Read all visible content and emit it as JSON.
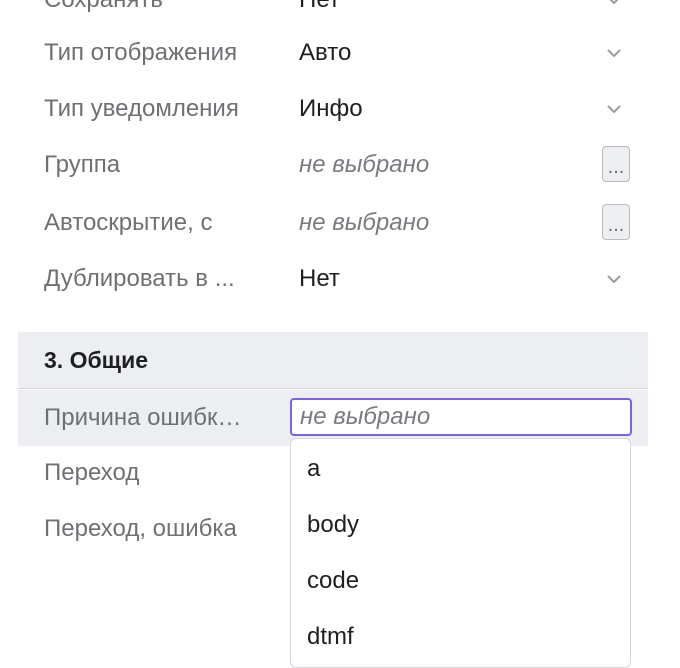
{
  "fields": {
    "save": {
      "label": "Сохранять",
      "value": "Нет"
    },
    "display_type": {
      "label": "Тип отображения",
      "value": "Авто"
    },
    "notification_type": {
      "label": "Тип уведомления",
      "value": "Инфо"
    },
    "group": {
      "label": "Группа",
      "value": "не выбрано",
      "button": "..."
    },
    "autohide": {
      "label": "Автоскрытие, с",
      "value": "не выбрано",
      "button": "..."
    },
    "duplicate": {
      "label": "Дублировать в ...",
      "value": "Нет"
    }
  },
  "section": {
    "title": "3. Общие"
  },
  "general": {
    "error_reason": {
      "label": "Причина ошибк…",
      "placeholder": "не выбрано"
    },
    "transition": {
      "label": "Переход"
    },
    "transition_error": {
      "label": "Переход, ошибка"
    }
  },
  "dropdown": {
    "options": [
      "a",
      "body",
      "code",
      "dtmf"
    ]
  },
  "colors": {
    "accent": "#7d62e8",
    "section_bg": "#eceef2",
    "label": "#6e7074"
  }
}
